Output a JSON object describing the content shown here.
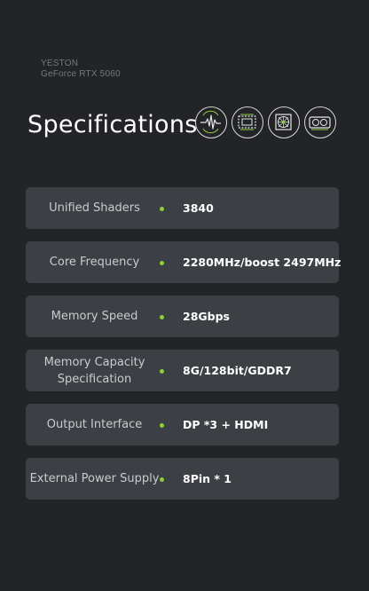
{
  "brand": {
    "name": "YESTON",
    "model": "GeForce RTX 5060"
  },
  "title": "Specifications",
  "icons": [
    "waveform-icon",
    "chip-board-icon",
    "cooling-fan-icon",
    "graphics-card-icon"
  ],
  "accent_color": "#8fcf3c",
  "specs": [
    {
      "label": "Unified Shaders",
      "value": "3840"
    },
    {
      "label": "Core Frequency",
      "value": "2280MHz/boost 2497MHz"
    },
    {
      "label": "Memory Speed",
      "value": "28Gbps"
    },
    {
      "label": "Memory Capacity Specification",
      "value": "8G/128bit/GDDR7"
    },
    {
      "label": "Output Interface",
      "value": "DP *3 + HDMI"
    },
    {
      "label": "External Power Supply",
      "value": "8Pin * 1"
    }
  ]
}
